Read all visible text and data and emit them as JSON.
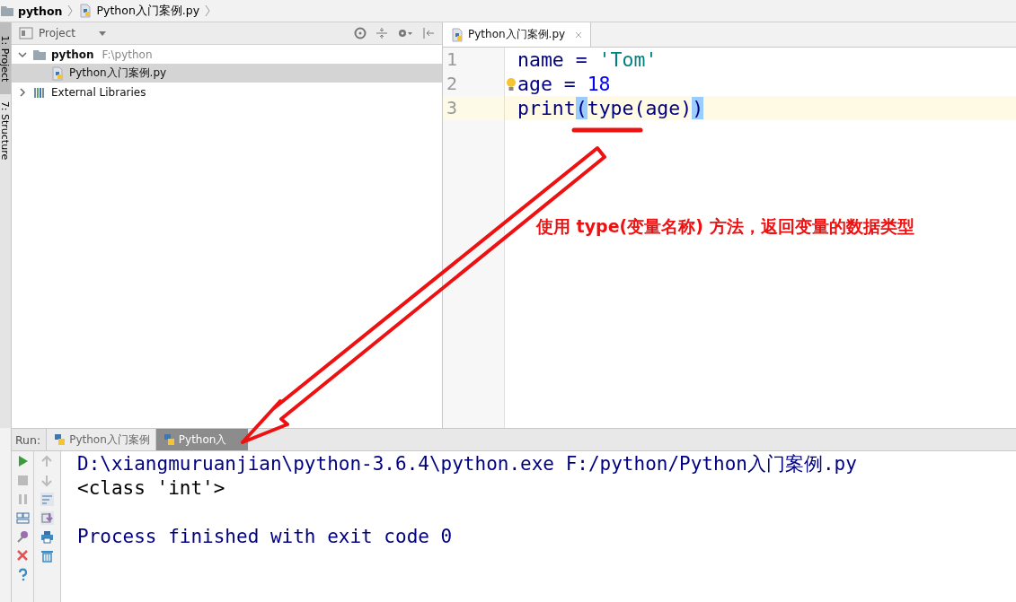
{
  "breadcrumb": [
    {
      "label": "python",
      "kind": "folder"
    },
    {
      "label": "Python入门案例.py",
      "kind": "file"
    }
  ],
  "side_tabs": [
    {
      "label": "1: Project",
      "selected": true
    },
    {
      "label": "7: Structure",
      "selected": false
    }
  ],
  "project_panel": {
    "title": "Project",
    "tree": [
      {
        "label": "python",
        "path": "F:\\python",
        "kind": "folder",
        "expanded": true,
        "selected": false,
        "children": [
          {
            "label": "Python入门案例.py",
            "kind": "file",
            "selected": true
          }
        ]
      },
      {
        "label": "External Libraries",
        "kind": "library",
        "expanded": false,
        "selected": false
      }
    ]
  },
  "editor": {
    "tabs": [
      {
        "label": "Python入门案例.py",
        "selected": true
      }
    ],
    "lines": [
      {
        "number": "1",
        "current": false,
        "tokens": [
          {
            "text": "name = ",
            "kind": "plain"
          },
          {
            "text": "'Tom'",
            "kind": "string"
          }
        ]
      },
      {
        "number": "2",
        "current": false,
        "tokens": [
          {
            "text": "age = ",
            "kind": "plain"
          },
          {
            "text": "18",
            "kind": "number"
          }
        ]
      },
      {
        "number": "3",
        "current": true,
        "tokens": [
          {
            "text": "print",
            "kind": "plain"
          },
          {
            "text": "(",
            "kind": "match"
          },
          {
            "text": "type(age)",
            "kind": "plain"
          },
          {
            "text": ")",
            "kind": "match"
          }
        ]
      }
    ]
  },
  "annotation": {
    "text": "使用 type(变量名称) 方法，返回变量的数据类型"
  },
  "run_panel": {
    "label": "Run:",
    "tabs": [
      {
        "label": "Python入门案例",
        "selected": false
      },
      {
        "label": "Python入",
        "selected": true
      }
    ],
    "console": [
      {
        "text": "D:\\xiangmuruanjian\\python-3.6.4\\python.exe F:/python/Python入门案例.py",
        "kind": "system"
      },
      {
        "text": "<class 'int'>",
        "kind": "output"
      },
      {
        "kind": "blank"
      },
      {
        "text": "Process finished with exit code 0",
        "kind": "system"
      }
    ]
  }
}
